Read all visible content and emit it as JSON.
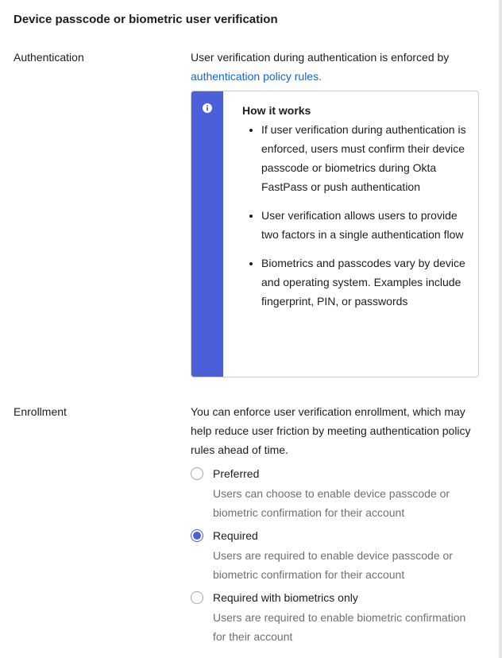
{
  "section": {
    "title": "Device passcode or biometric user verification"
  },
  "authentication": {
    "label": "Authentication",
    "text": "User verification during authentication is enforced by",
    "link": "authentication policy rules."
  },
  "callout": {
    "icon": "info-icon",
    "title": "How it works",
    "items": [
      "If user verification during authentication is enforced, users must confirm their device passcode or biometrics during Okta FastPass or push authentication",
      "User verification allows users to provide two factors in a single authentication flow",
      "Biometrics and passcodes vary by device and operating system. Examples include fingerprint, PIN, or passwords"
    ],
    "accent_color": "#4b5fd9"
  },
  "enrollment": {
    "label": "Enrollment",
    "text": "You can enforce user verification enrollment, which may help reduce user friction by meeting authentication policy rules ahead of time.",
    "options": [
      {
        "label": "Preferred",
        "description": "Users can choose to enable device passcode or biometric confirmation for their account",
        "selected": false
      },
      {
        "label": "Required",
        "description": "Users are required to enable device passcode or biometric confirmation for their account",
        "selected": true
      },
      {
        "label": "Required with biometrics only",
        "description": "Users are required to enable biometric confirmation for their account",
        "selected": false
      }
    ]
  },
  "colors": {
    "link": "#1662dd",
    "accent": "#4b5fd9",
    "muted_text": "#6e6e78"
  }
}
